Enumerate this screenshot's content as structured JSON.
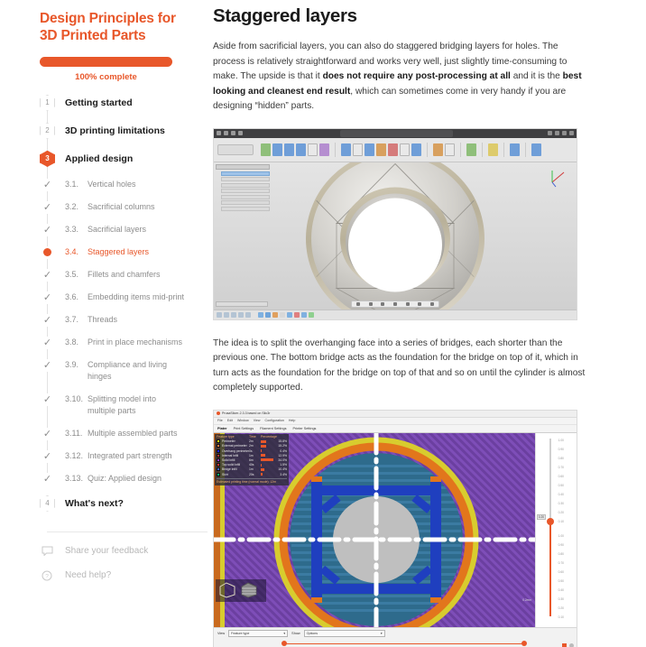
{
  "sidebar": {
    "course_title": "Design Principles for 3D Printed Parts",
    "progress": {
      "percent": 100,
      "label": "100% complete",
      "color": "#E8572A"
    },
    "sections": [
      {
        "badge": "1",
        "label": "Getting started",
        "state": "done"
      },
      {
        "badge": "2",
        "label": "3D printing limitations",
        "state": "done"
      },
      {
        "badge": "3",
        "label": "Applied design",
        "state": "current"
      }
    ],
    "lessons": [
      {
        "num": "3.1.",
        "text": "Vertical holes",
        "state": "done"
      },
      {
        "num": "3.2.",
        "text": "Sacrificial columns",
        "state": "done"
      },
      {
        "num": "3.3.",
        "text": "Sacrificial layers",
        "state": "done"
      },
      {
        "num": "3.4.",
        "text": "Staggered layers",
        "state": "active"
      },
      {
        "num": "3.5.",
        "text": "Fillets and chamfers",
        "state": "done"
      },
      {
        "num": "3.6.",
        "text": "Embedding items mid-print",
        "state": "done"
      },
      {
        "num": "3.7.",
        "text": "Threads",
        "state": "done"
      },
      {
        "num": "3.8.",
        "text": "Print in place mechanisms",
        "state": "done"
      },
      {
        "num": "3.9.",
        "text": "Compliance and living hinges",
        "state": "done"
      },
      {
        "num": "3.10.",
        "text": "Splitting model into multiple parts",
        "state": "done"
      },
      {
        "num": "3.11.",
        "text": "Multiple assembled parts",
        "state": "done"
      },
      {
        "num": "3.12.",
        "text": "Integrated part strength",
        "state": "done"
      },
      {
        "num": "3.13.",
        "text": "Quiz: Applied design",
        "state": "done"
      }
    ],
    "next_section": {
      "badge": "4",
      "label": "What's next?",
      "state": "todo"
    },
    "footer": [
      {
        "icon": "speech-bubble-icon",
        "label": "Share your feedback"
      },
      {
        "icon": "question-circle-icon",
        "label": "Need help?"
      }
    ],
    "check_glyph": "✓"
  },
  "main": {
    "title": "Staggered layers",
    "paragraph1": {
      "part1": "Aside from sacrificial layers, you can also do staggered bridging layers for holes. The process is relatively straightforward and works very well, just slightly time-consuming to make. The upside is that it ",
      "bold1": "does not require any post-processing at all",
      "part2": " and it is the ",
      "bold2": "best looking and cleanest end result",
      "part3": ", which can sometimes come in very handy if you are designing “hidden” parts."
    },
    "paragraph2": "The idea is to split the overhanging face into a series of bridges, each shorter than the previous one. The bottom bridge acts as the foundation for the bridge on top of it, which in turn acts as the foundation for the bridge on top of that and so on until the cylinder is almost completely supported."
  },
  "figure_cad": {
    "name": "fusion-360-cad-screenshot",
    "titlebar_tab": "Design Name",
    "tree_rows": [
      "Document Settings",
      "Named Views",
      "Origin",
      "Bodies",
      "Sketches",
      "Construction"
    ],
    "description": "3D CAD view of a torus with staggered triangular bridging layers inside a circular hole"
  },
  "figure_slicer": {
    "name": "prusaslicer-preview-screenshot",
    "window_title": "PrusaSlicer-2.3.3 based on Slic3r",
    "menus": [
      "File",
      "Edit",
      "Window",
      "View",
      "Configuration",
      "Help"
    ],
    "tabs": [
      "Plater",
      "Print Settings",
      "Filament Settings",
      "Printer Settings"
    ],
    "selected_tab": "Plater",
    "legend": {
      "headers": [
        "Feature type",
        "Time",
        "Percentage"
      ],
      "rows": [
        {
          "name": "Perimeter",
          "color": "#FFFF00",
          "time": "2m",
          "percent": "15.8%",
          "bar": 40
        },
        {
          "name": "External perimeter",
          "color": "#FF7D38",
          "time": "2m",
          "percent": "15.2%",
          "bar": 38
        },
        {
          "name": "Overhang perimeter",
          "color": "#1F1FFF",
          "time": "0s",
          "percent": "0.4%",
          "bar": 3
        },
        {
          "name": "Internal infill",
          "color": "#B03030",
          "time": "1m",
          "percent": "12.9%",
          "bar": 33
        },
        {
          "name": "Solid infill",
          "color": "#9933CC",
          "time": "6m",
          "percent": "34.0%",
          "bar": 85
        },
        {
          "name": "Top solid infill",
          "color": "#FF3333",
          "time": "40s",
          "percent": "1.5%",
          "bar": 6
        },
        {
          "name": "Bridge infill",
          "color": "#3C5FCC",
          "time": "1m",
          "percent": "10.4%",
          "bar": 26
        },
        {
          "name": "Skirt",
          "color": "#00B26B",
          "time": "20s",
          "percent": "3.4%",
          "bar": 10
        }
      ],
      "footer": "Estimated printing time (normal mode): 12m"
    },
    "controls": {
      "view_label": "View",
      "view_value": "Feature type",
      "show_label": "Show",
      "show_value": "Options"
    },
    "vertical_slider_ticks": [
      "1.00",
      "0.90",
      "0.80",
      "0.70",
      "0.60",
      "0.50",
      "0.40",
      "0.30",
      "0.20",
      "0.10",
      "1.00",
      "0.90",
      "0.80",
      "0.70",
      "0.60",
      "0.50",
      "0.40",
      "0.30",
      "0.20",
      "0.10"
    ],
    "slider_value": "0.20",
    "colors": {
      "infill_purple": "#6B3FA0",
      "perimeter_orange": "#E2761C",
      "perimeter_yellow": "#D8CC2E",
      "bridge_blue": "#1F3FBF",
      "solid_teal": "#2E6B8C",
      "hole_gray": "#BFBFBF"
    }
  }
}
